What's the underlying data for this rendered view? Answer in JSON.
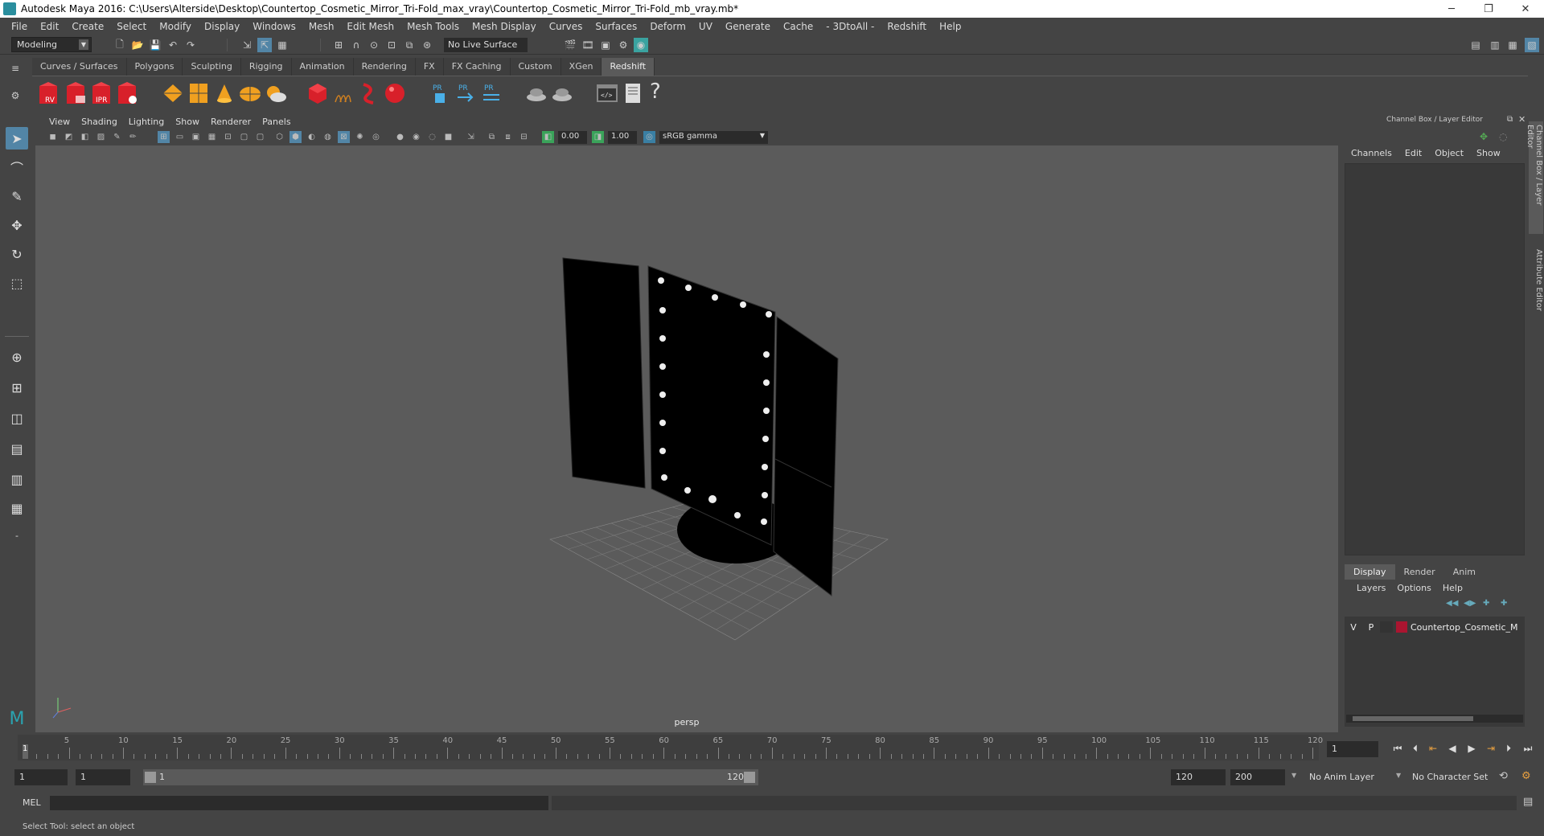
{
  "window": {
    "title": "Autodesk Maya 2016: C:\\Users\\Alterside\\Desktop\\Countertop_Cosmetic_Mirror_Tri-Fold_max_vray\\Countertop_Cosmetic_Mirror_Tri-Fold_mb_vray.mb*",
    "minimize": "─",
    "restore": "❐",
    "close": "✕"
  },
  "menu": [
    "File",
    "Edit",
    "Create",
    "Select",
    "Modify",
    "Display",
    "Windows",
    "Mesh",
    "Edit Mesh",
    "Mesh Tools",
    "Mesh Display",
    "Curves",
    "Surfaces",
    "Deform",
    "UV",
    "Generate",
    "Cache",
    "- 3DtoAll -",
    "Redshift",
    "Help"
  ],
  "status_line": {
    "mode": "Modeling",
    "live_surface": "No Live Surface"
  },
  "shelf": {
    "tabs": [
      "Curves / Surfaces",
      "Polygons",
      "Sculpting",
      "Rigging",
      "Animation",
      "Rendering",
      "FX",
      "FX Caching",
      "Custom",
      "XGen",
      "Redshift"
    ],
    "active_tab": "Redshift",
    "icon_labels": [
      "RV",
      "",
      "IPR",
      ""
    ]
  },
  "viewport": {
    "menu": [
      "View",
      "Shading",
      "Lighting",
      "Show",
      "Renderer",
      "Panels"
    ],
    "near_value": "0.00",
    "gamma_value": "1.00",
    "color_space": "sRGB gamma",
    "camera_label": "persp"
  },
  "right_panel": {
    "title": "Channel Box / Layer Editor",
    "channel_menu": [
      "Channels",
      "Edit",
      "Object",
      "Show"
    ],
    "layer_tabs": [
      "Display",
      "Render",
      "Anim"
    ],
    "active_layer_tab": "Display",
    "layer_menu": [
      "Layers",
      "Options",
      "Help"
    ],
    "layer": {
      "v": "V",
      "p": "P",
      "name": "Countertop_Cosmetic_M",
      "color": "#aa1530"
    },
    "side_tabs": [
      "Channel Box / Layer Editor",
      "Attribute Editor"
    ]
  },
  "timeline": {
    "tick_labels": [
      "5",
      "10",
      "15",
      "20",
      "25",
      "30",
      "35",
      "40",
      "45",
      "50",
      "55",
      "60",
      "65",
      "70",
      "75",
      "80",
      "85",
      "90",
      "95",
      "100",
      "105",
      "110",
      "115",
      "120"
    ],
    "current_frame_marker": "1",
    "current_frame_field": "1"
  },
  "range": {
    "start": "1",
    "playback_start": "1",
    "range_start_label": "1",
    "range_end_label": "120",
    "playback_end": "120",
    "end": "200",
    "anim_layer": "No Anim Layer",
    "character_set": "No Character Set"
  },
  "command": {
    "label": "MEL",
    "help": "Select Tool: select an object"
  }
}
